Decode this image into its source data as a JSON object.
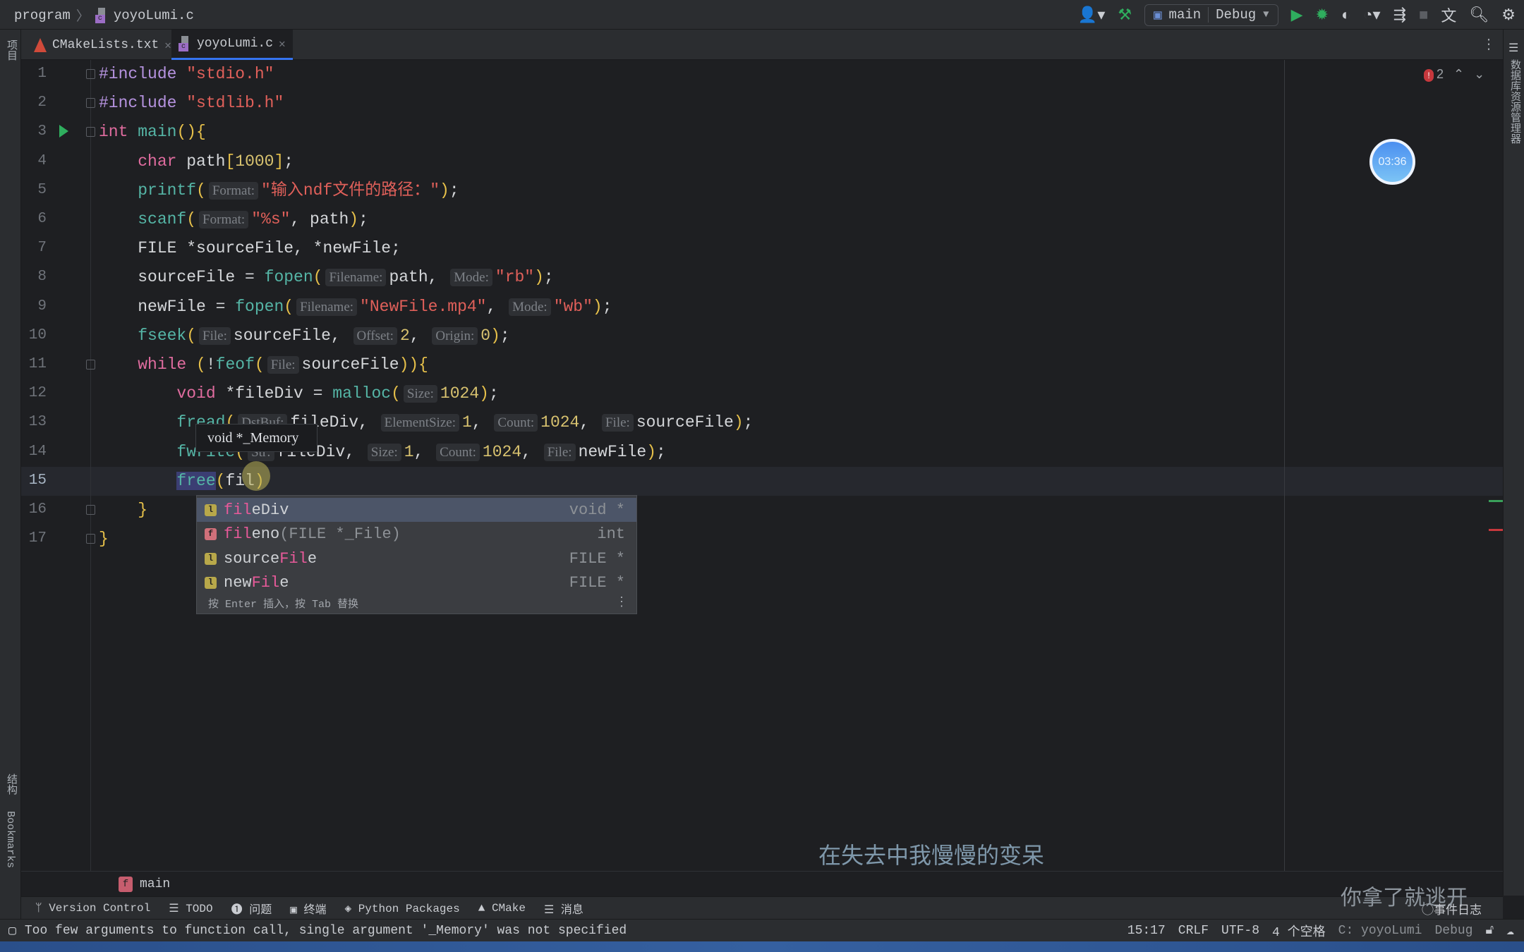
{
  "breadcrumb": {
    "project": "program",
    "file": "yoyoLumi.c"
  },
  "toolbar": {
    "config": "main",
    "profile": "Debug",
    "icons": [
      "user-icon",
      "hammer-icon",
      "run-icon",
      "debug-icon",
      "coverage-icon",
      "profile-icon",
      "attach-icon",
      "stop-icon",
      "translate-icon",
      "search-icon",
      "settings-icon"
    ]
  },
  "tabs": [
    {
      "label": "CMakeLists.txt",
      "active": false
    },
    {
      "label": "yoyoLumi.c",
      "active": true
    }
  ],
  "left_strip": {
    "top": "项目",
    "structure": "结构",
    "bookmarks": "Bookmarks"
  },
  "right_strip": {
    "label": "数据库资源管理器"
  },
  "errors": {
    "count": "2"
  },
  "clock": "03:36",
  "code": {
    "current_line": 15,
    "lines": [
      [
        {
          "t": "#include ",
          "c": "p"
        },
        {
          "t": "\"stdio.h\"",
          "c": "s"
        }
      ],
      [
        {
          "t": "#include ",
          "c": "p"
        },
        {
          "t": "\"stdlib.h\"",
          "c": "s"
        }
      ],
      [
        {
          "t": "int ",
          "c": "k"
        },
        {
          "t": "main",
          "c": "f"
        },
        {
          "t": "(){",
          "c": "b"
        }
      ],
      [
        {
          "t": "    ",
          "c": "t"
        },
        {
          "t": "char ",
          "c": "k"
        },
        {
          "t": "path",
          "c": "t"
        },
        {
          "t": "[",
          "c": "b"
        },
        {
          "t": "1000",
          "c": "n"
        },
        {
          "t": "]",
          "c": "b"
        },
        {
          "t": ";",
          "c": "t"
        }
      ],
      [
        {
          "t": "    ",
          "c": "t"
        },
        {
          "t": "printf",
          "c": "f"
        },
        {
          "t": "(",
          "c": "b"
        },
        {
          "t": "Format:",
          "c": "h"
        },
        {
          "t": "\"输入ndf文件的路径：\"",
          "c": "s"
        },
        {
          "t": ")",
          "c": "b"
        },
        {
          "t": ";",
          "c": "t"
        }
      ],
      [
        {
          "t": "    ",
          "c": "t"
        },
        {
          "t": "scanf",
          "c": "f"
        },
        {
          "t": "(",
          "c": "b"
        },
        {
          "t": "Format:",
          "c": "h"
        },
        {
          "t": "\"%s\"",
          "c": "s"
        },
        {
          "t": ", path",
          "c": "t"
        },
        {
          "t": ")",
          "c": "b"
        },
        {
          "t": ";",
          "c": "t"
        }
      ],
      [
        {
          "t": "    FILE *sourceFile, *newFile;",
          "c": "t"
        }
      ],
      [
        {
          "t": "    sourceFile = ",
          "c": "t"
        },
        {
          "t": "fopen",
          "c": "f"
        },
        {
          "t": "(",
          "c": "b"
        },
        {
          "t": "Filename:",
          "c": "h"
        },
        {
          "t": "path, ",
          "c": "t"
        },
        {
          "t": "Mode:",
          "c": "h"
        },
        {
          "t": "\"rb\"",
          "c": "s"
        },
        {
          "t": ")",
          "c": "b"
        },
        {
          "t": ";",
          "c": "t"
        }
      ],
      [
        {
          "t": "    newFile = ",
          "c": "t"
        },
        {
          "t": "fopen",
          "c": "f"
        },
        {
          "t": "(",
          "c": "b"
        },
        {
          "t": "Filename:",
          "c": "h"
        },
        {
          "t": "\"NewFile.mp4\"",
          "c": "s"
        },
        {
          "t": ", ",
          "c": "t"
        },
        {
          "t": "Mode:",
          "c": "h"
        },
        {
          "t": "\"wb\"",
          "c": "s"
        },
        {
          "t": ")",
          "c": "b"
        },
        {
          "t": ";",
          "c": "t"
        }
      ],
      [
        {
          "t": "    ",
          "c": "t"
        },
        {
          "t": "fseek",
          "c": "f"
        },
        {
          "t": "(",
          "c": "b"
        },
        {
          "t": "File:",
          "c": "h"
        },
        {
          "t": "sourceFile, ",
          "c": "t"
        },
        {
          "t": "Offset:",
          "c": "h"
        },
        {
          "t": "2",
          "c": "n"
        },
        {
          "t": ", ",
          "c": "t"
        },
        {
          "t": "Origin:",
          "c": "h"
        },
        {
          "t": "0",
          "c": "n"
        },
        {
          "t": ")",
          "c": "b"
        },
        {
          "t": ";",
          "c": "t"
        }
      ],
      [
        {
          "t": "    ",
          "c": "t"
        },
        {
          "t": "while ",
          "c": "k"
        },
        {
          "t": "(",
          "c": "b"
        },
        {
          "t": "!",
          "c": "t"
        },
        {
          "t": "feof",
          "c": "f"
        },
        {
          "t": "(",
          "c": "b"
        },
        {
          "t": "File:",
          "c": "h"
        },
        {
          "t": "sourceFile",
          "c": "t"
        },
        {
          "t": ")){",
          "c": "b"
        }
      ],
      [
        {
          "t": "        ",
          "c": "t"
        },
        {
          "t": "void ",
          "c": "k"
        },
        {
          "t": "*fileDiv = ",
          "c": "t"
        },
        {
          "t": "malloc",
          "c": "f"
        },
        {
          "t": "(",
          "c": "b"
        },
        {
          "t": "Size:",
          "c": "h"
        },
        {
          "t": "1024",
          "c": "n"
        },
        {
          "t": ")",
          "c": "b"
        },
        {
          "t": ";",
          "c": "t"
        }
      ],
      [
        {
          "t": "        ",
          "c": "t"
        },
        {
          "t": "fread",
          "c": "f"
        },
        {
          "t": "(",
          "c": "b"
        },
        {
          "t": "DstBuf:",
          "c": "h"
        },
        {
          "t": "fileDiv, ",
          "c": "t"
        },
        {
          "t": "ElementSize:",
          "c": "h"
        },
        {
          "t": "1",
          "c": "n"
        },
        {
          "t": ", ",
          "c": "t"
        },
        {
          "t": "Count:",
          "c": "h"
        },
        {
          "t": "1024",
          "c": "n"
        },
        {
          "t": ", ",
          "c": "t"
        },
        {
          "t": "File:",
          "c": "h"
        },
        {
          "t": "sourceFile",
          "c": "t"
        },
        {
          "t": ")",
          "c": "b"
        },
        {
          "t": ";",
          "c": "t"
        }
      ],
      [
        {
          "t": "        ",
          "c": "t"
        },
        {
          "t": "fwrite",
          "c": "f"
        },
        {
          "t": "(",
          "c": "b"
        },
        {
          "t": "Str:",
          "c": "h"
        },
        {
          "t": "fileDiv, ",
          "c": "t"
        },
        {
          "t": "Size:",
          "c": "h"
        },
        {
          "t": "1",
          "c": "n"
        },
        {
          "t": ", ",
          "c": "t"
        },
        {
          "t": "Count:",
          "c": "h"
        },
        {
          "t": "1024",
          "c": "n"
        },
        {
          "t": ", ",
          "c": "t"
        },
        {
          "t": "File:",
          "c": "h"
        },
        {
          "t": "newFile",
          "c": "t"
        },
        {
          "t": ")",
          "c": "b"
        },
        {
          "t": ";",
          "c": "t"
        }
      ],
      [
        {
          "t": "        ",
          "c": "t"
        },
        {
          "t": "free",
          "c": "f sel"
        },
        {
          "t": "(",
          "c": "b"
        },
        {
          "t": "fil",
          "c": "t"
        },
        {
          "t": ")",
          "c": "b"
        }
      ],
      [
        {
          "t": "    ",
          "c": "t"
        },
        {
          "t": "}",
          "c": "b"
        }
      ],
      [
        {
          "t": "}",
          "c": "b"
        }
      ]
    ]
  },
  "tooltip": "void *_Memory",
  "completion": {
    "items": [
      {
        "icon": "l",
        "match": "fil",
        "rest": "eDiv",
        "sig": "",
        "type": "void *",
        "selected": true
      },
      {
        "icon": "f",
        "match": "fil",
        "rest": "eno",
        "sig": "(FILE *_File)",
        "type": "int",
        "selected": false
      },
      {
        "icon": "l",
        "prefix": "source",
        "match": "Fil",
        "rest": "e",
        "sig": "",
        "type": "FILE *",
        "selected": false
      },
      {
        "icon": "l",
        "prefix": "new",
        "match": "Fil",
        "rest": "e",
        "sig": "",
        "type": "FILE *",
        "selected": false
      }
    ],
    "footer": "按 Enter 插入，按 Tab 替换"
  },
  "subtitles": [
    "在失去中我慢慢的变呆",
    "你拿了就逃开"
  ],
  "nav_crumb": "main",
  "tool_windows": [
    "Version Control",
    "TODO",
    "问题",
    "终端",
    "Python Packages",
    "CMake",
    "消息"
  ],
  "event_log": "事件日志",
  "status": {
    "message": "Too few arguments to function call, single argument '_Memory' was not specified",
    "position": "15:17",
    "line_sep": "CRLF",
    "encoding": "UTF-8",
    "indent": "4 个空格",
    "context": "C: yoyoLumi",
    "profile": "Debug"
  }
}
